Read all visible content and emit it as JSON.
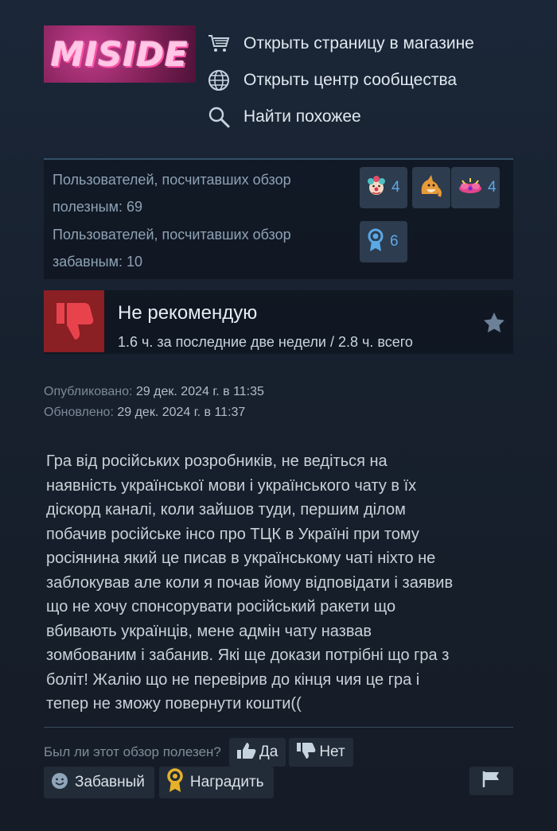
{
  "game": {
    "logo_text": "MISIDE"
  },
  "links": [
    {
      "label": "Открыть страницу в магазине",
      "icon": "cart-icon"
    },
    {
      "label": "Открыть центр сообщества",
      "icon": "globe-icon"
    },
    {
      "label": "Найти похожее",
      "icon": "search-icon"
    }
  ],
  "stats": {
    "helpful_text": "Пользователей, посчитавших обзор полезным: 69",
    "funny_text": "Пользователей, посчитавших обзор забавным: 10",
    "awards": [
      {
        "icon": "clown-award-icon",
        "count": "4"
      },
      {
        "icon": "fox-award-icon",
        "count": ""
      },
      {
        "icon": "party-award-icon",
        "count": "4"
      },
      {
        "icon": "ribbon-award-icon",
        "count": "6"
      }
    ]
  },
  "review": {
    "verdict": "Не рекомендую",
    "hours": "1.6 ч. за последние две недели / 2.8 ч. всего",
    "published_label": "Опубликовано:",
    "published_value": "29 дек. 2024 г. в 11:35",
    "updated_label": "Обновлено:",
    "updated_value": "29 дек. 2024 г. в 11:37",
    "lines": [
      "Гра від російських розробників, не ведіться на",
      "наявність української мови і українського чату в їх",
      "діскорд каналі, коли зайшов туди, першим ділом",
      "побачив російське інсо про ТЦК в Україні при тому",
      "росіянина який це писав в українському чаті ніхто не",
      "заблокував але коли я почав йому відповідати і заявив",
      "що не хочу спонсорувати російський ракети що",
      "вбивають українців, мене адмін чату назвав",
      "зомбованим і забанив. Які ще докази потрібні що гра з",
      "боліт! Жалію що не перевірив до кінця чия це гра і",
      "тепер не зможу повернути кошти(("
    ]
  },
  "feedback": {
    "question": "Был ли этот обзор полезен?",
    "yes_label": "Да",
    "no_label": "Нет",
    "funny_label": "Забавный",
    "award_label": "Наградить"
  }
}
